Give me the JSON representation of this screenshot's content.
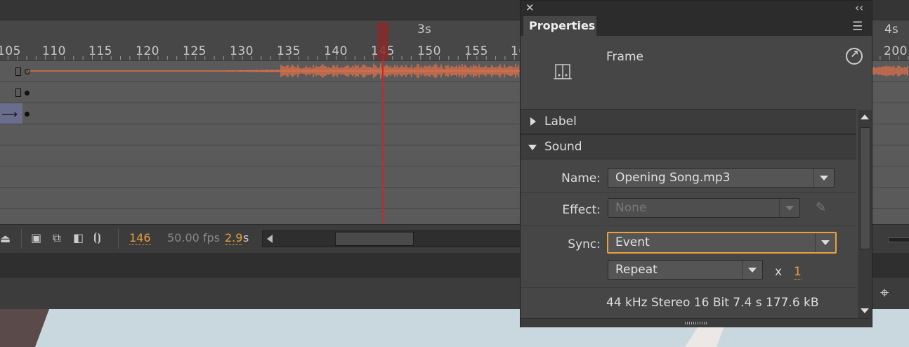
{
  "timeline": {
    "seconds": [
      "3s",
      "4s"
    ],
    "frame_ticks": [
      "105",
      "110",
      "115",
      "120",
      "125",
      "130",
      "135",
      "140",
      "145",
      "150",
      "155",
      "16",
      "200"
    ],
    "current_frame": "146",
    "fps": "50.00 fps",
    "elapsed": "2.9",
    "elapsed_unit": "s"
  },
  "properties": {
    "close_glyph": "✕",
    "collapse_glyph": "‹‹",
    "tab_label": "Properties",
    "frame_label": "Frame",
    "sections": {
      "label": "Label",
      "sound": "Sound"
    },
    "sound": {
      "name_label": "Name:",
      "name_value": "Opening Song.mp3",
      "effect_label": "Effect:",
      "effect_value": "None",
      "sync_label": "Sync:",
      "sync_value": "Event",
      "repeat_value": "Repeat",
      "times_label": "x",
      "repeat_count": "1",
      "info": "44 kHz Stereo 16 Bit 7.4 s 177.6 kB"
    }
  },
  "colors": {
    "accent": "#e8a23a",
    "waveform": "#e0704a",
    "playhead": "#c32a2a"
  }
}
